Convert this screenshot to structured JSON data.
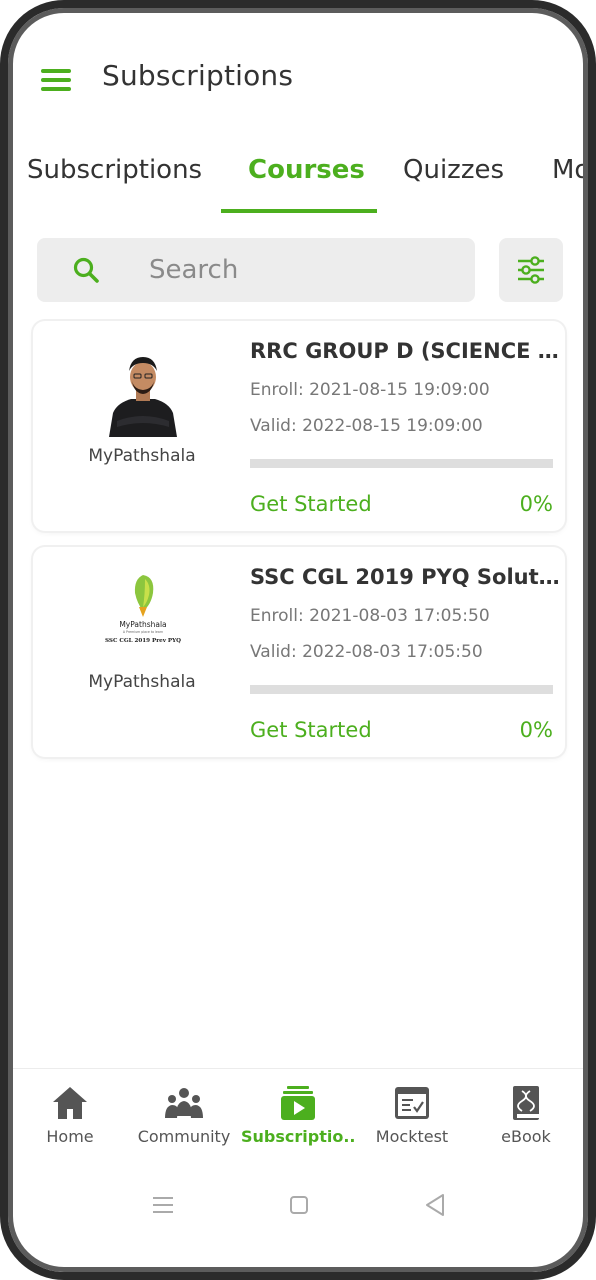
{
  "app": {
    "title": "Subscriptions"
  },
  "tabs": [
    {
      "label": "Subscriptions"
    },
    {
      "label": "Courses",
      "active": true
    },
    {
      "label": "Quizzes"
    },
    {
      "label": "Mo"
    }
  ],
  "search": {
    "placeholder": "Search"
  },
  "icons": {
    "menu": "hamburger-menu-icon",
    "search": "search-icon",
    "filter": "sliders-filter-icon"
  },
  "courses": [
    {
      "title": "RRC GROUP D (SCIENCE +G...",
      "enroll": "Enroll: 2021-08-15 19:09:00",
      "valid": "Valid: 2022-08-15 19:09:00",
      "provider": "MyPathshala",
      "progress_fraction": 0,
      "progress_text": "0%",
      "cta": "Get Started",
      "thumbnail": "instructor-photo"
    },
    {
      "title": "SSC CGL 2019 PYQ Solution ...",
      "enroll": "Enroll: 2021-08-03 17:05:50",
      "valid": "Valid: 2022-08-03 17:05:50",
      "provider": "MyPathshala",
      "progress_fraction": 0,
      "progress_text": "0%",
      "cta": "Get Started",
      "thumbnail": "mypathshala-logo",
      "thumb_text": {
        "brand": "MyPathshala",
        "tagline": "A Premium place to learn",
        "subtitle": "SSC CGL 2019 Prev PYQ"
      }
    }
  ],
  "bottom_nav": [
    {
      "label": "Home",
      "icon": "home-icon"
    },
    {
      "label": "Community",
      "icon": "community-icon"
    },
    {
      "label": "Subscriptio...",
      "icon": "subscriptions-play-icon",
      "active": true
    },
    {
      "label": "Mocktest",
      "icon": "mocktest-icon"
    },
    {
      "label": "eBook",
      "icon": "ebook-icon"
    }
  ],
  "colors": {
    "accent": "#4caf1e",
    "text": "#333333",
    "muted": "#777777",
    "track": "#dedede"
  }
}
